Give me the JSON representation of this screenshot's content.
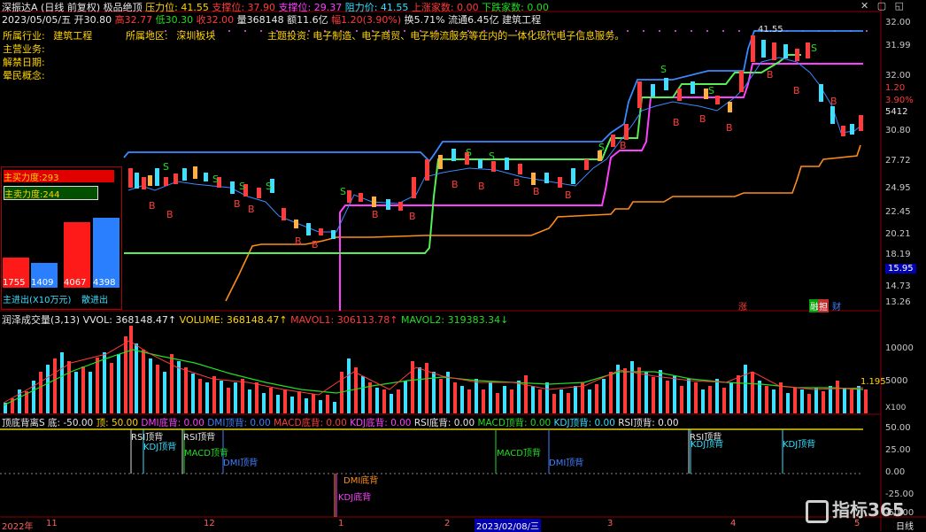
{
  "header": {
    "title": "深振达A",
    "period": "(日线 前复权)",
    "indicator": "极品绝顶",
    "pressure": "压力位: 41.55",
    "swing": "支撑位: 37.90",
    "support": "支撑位: 29.37",
    "resist": "阻力价: 41.55",
    "up_count": "上涨家数: 0.00",
    "down_count": "下跌家数: 0.00"
  },
  "quote": {
    "date": "2023/05/05/五",
    "open": "开30.80",
    "high": "高32.77",
    "low": "低30.30",
    "close": "收32.00",
    "volume": "量368148",
    "amount": "额11.6亿",
    "change": "幅1.20",
    "pct": "(3.90%)",
    "turnover": "换5.71%",
    "float": "流通6.45亿",
    "sector": "建筑工程"
  },
  "info": {
    "industry_label": "所属行业:",
    "industry_value": "建筑工程",
    "region_label": "所属地区:",
    "region_value": "深圳板块",
    "business_label": "主营业务:",
    "theme_label": "主题投资:",
    "theme_value": "电子制造、电子商贸、电子物流服务等在内的一体化现代电子信息服务。",
    "unlock_label": "解禁日期:",
    "concept_label": "晕民概念:"
  },
  "power": {
    "buy_label": "主买力度:293",
    "sell_label": "主卖力度:244",
    "bar1": "1755",
    "bar2": "1409",
    "bar3": "4067",
    "bar4": "4398",
    "footer1": "主进出(X10万元)",
    "footer2": "散进出"
  },
  "price_axis": [
    "32.00",
    "31.99",
    "32.00",
    "3.90%",
    "1.20",
    "5412",
    "30.80",
    "27.72",
    "24.95",
    "22.45",
    "20.21",
    "18.19",
    "15.95",
    "14.73",
    "13.26"
  ],
  "volume_panel": {
    "title": "润泽成交量(3,13)",
    "vvol": "VVOL: 368148.47↑",
    "volume": "VOLUME: 368148.47↑",
    "mavol1": "MAVOL1: 306113.78↑",
    "mavol2": "MAVOL2: 319383.34↓",
    "axis": [
      "10000",
      "5000",
      "1.195",
      "X100"
    ]
  },
  "div_panel": {
    "title": "顶底背离S",
    "bottom": "底: -50.00",
    "top": "顶: 50.00",
    "dmi_bottom": "DMI底背: 0.00",
    "dmi_top": "DMI顶背: 0.00",
    "macd_bottom": "MACD底背: 0.00",
    "kdj_bottom": "KDJ底背: 0.00",
    "rsi_bottom": "RSI底背: 0.00",
    "macd_top": "MACD顶背: 0.00",
    "kdj_top": "KDJ顶背: 0.00",
    "rsi_top": "RSI顶背: 0.00",
    "axis": [
      "50.00",
      "25.00",
      "0.00",
      "-25.00",
      "-50.00"
    ],
    "labels": {
      "rsi1": "RSI顶背",
      "kdj1": "KDJ顶背",
      "rsi2": "RSI顶背",
      "macd1": "MACD顶背",
      "dmi1": "DMI顶背",
      "dmib": "DMI底背",
      "kdjb": "KDJ底背",
      "macd2": "MACD顶背",
      "dmi2": "DMI顶背",
      "rsi3": "RSI顶背",
      "kdj2": "KDJ顶背",
      "kdj3": "KDJ顶背"
    }
  },
  "xaxis": {
    "y2022": "2022年",
    "m11": "11",
    "m12": "12",
    "m1": "1",
    "m2": "2",
    "cursor": "2023/02/08/三",
    "m3": "3",
    "m4": "4",
    "m5": "5",
    "period": "日线"
  },
  "markers": {
    "zhang": "涨",
    "rong": "融",
    "dan": "担",
    "cai": "财",
    "peak": "41.55"
  },
  "watermark": "指标365"
}
